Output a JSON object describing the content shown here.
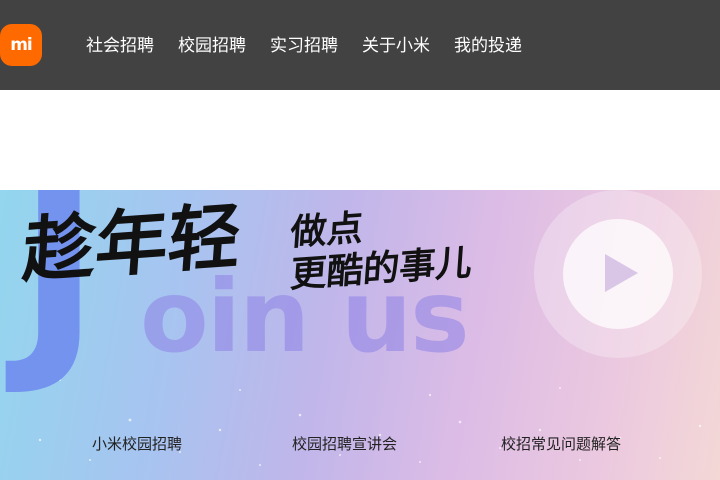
{
  "header": {
    "logo_text": "mi",
    "logo_color": "#ff6a00",
    "background": "#424242",
    "nav": [
      {
        "label": "社会招聘"
      },
      {
        "label": "校园招聘"
      },
      {
        "label": "实习招聘"
      },
      {
        "label": "关于小米"
      },
      {
        "label": "我的投递"
      }
    ]
  },
  "banner": {
    "headline_main": "趁年轻",
    "headline_sub_line1": "做点",
    "headline_sub_line2": "更酷的事儿",
    "decorative_letter": "J",
    "decorative_text": "oin us",
    "play_icon": "play-icon",
    "links": [
      {
        "label": "小米校园招聘"
      },
      {
        "label": "校园招聘宣讲会"
      },
      {
        "label": "校招常见问题解答"
      }
    ]
  }
}
